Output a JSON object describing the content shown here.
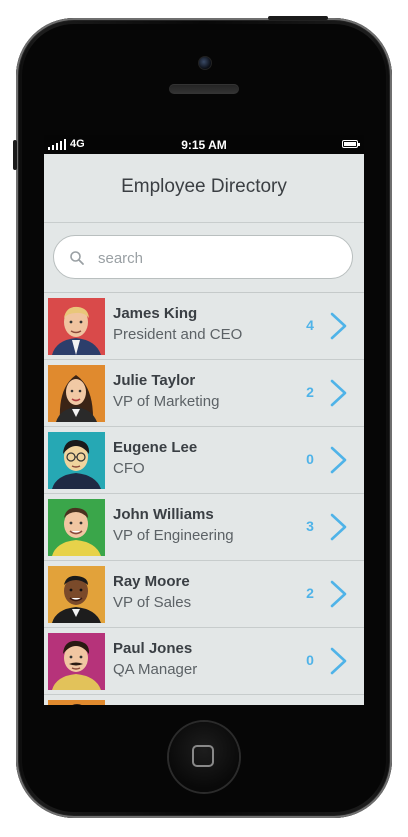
{
  "status_bar": {
    "network": "4G",
    "time": "9:15 AM"
  },
  "header": {
    "title": "Employee Directory"
  },
  "search": {
    "placeholder": "search",
    "icon": "search-icon"
  },
  "colors": {
    "accent": "#4fb3e8",
    "background": "#e3e7e7",
    "text_primary": "#3a3f44",
    "text_secondary": "#5c6266"
  },
  "employees": [
    {
      "name": "James King",
      "title": "President and CEO",
      "count": "4",
      "avatar_bg": "#d94a4a"
    },
    {
      "name": "Julie Taylor",
      "title": "VP of Marketing",
      "count": "2",
      "avatar_bg": "#e08a2e"
    },
    {
      "name": "Eugene Lee",
      "title": "CFO",
      "count": "0",
      "avatar_bg": "#26a8b4"
    },
    {
      "name": "John Williams",
      "title": "VP of Engineering",
      "count": "3",
      "avatar_bg": "#3aa64a"
    },
    {
      "name": "Ray Moore",
      "title": "VP of Sales",
      "count": "2",
      "avatar_bg": "#e2a23a"
    },
    {
      "name": "Paul Jones",
      "title": "QA Manager",
      "count": "0",
      "avatar_bg": "#b6337a"
    },
    {
      "name": "",
      "title": "",
      "count": "",
      "avatar_bg": "#e08a2e"
    }
  ]
}
